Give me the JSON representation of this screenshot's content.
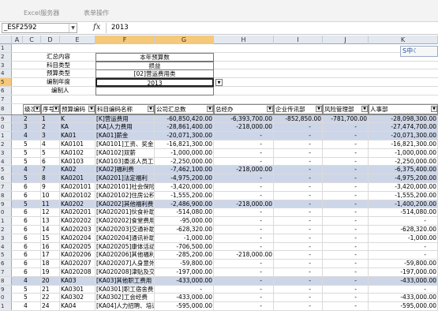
{
  "ribbon": {
    "tab1": "Excel服务器",
    "tab2": "表单操作"
  },
  "formula": {
    "namebox": "_ESF2592",
    "fx": "fx",
    "value": "2013"
  },
  "columns": [
    "A",
    "C",
    "D",
    "E",
    "F",
    "G",
    "H",
    "I",
    "J",
    "K"
  ],
  "row_numbers": [
    "1",
    "2",
    "3",
    "4",
    "5",
    "6",
    "7",
    "8",
    "9",
    "0",
    "1",
    "2",
    "3",
    "4",
    "5",
    "6",
    "7",
    "8",
    "9",
    "0",
    "1",
    "2",
    "3",
    "4",
    "5",
    "6",
    "7",
    "8",
    "9",
    "0",
    "1",
    "2"
  ],
  "form": {
    "l1": "汇总内容",
    "v1": "本年预算数",
    "l2": "科目类型",
    "v2": "损益",
    "l3": "预算类型",
    "v3": "[02]营运费用类",
    "l4": "编制年度",
    "v4": "2013",
    "l5": "编制人",
    "v5": ""
  },
  "headers": [
    "级次",
    "序号",
    "预算编码",
    "科目编码名称",
    "公司汇总数",
    "总经办",
    "企业传讯部",
    "风险管理部",
    "人事部"
  ],
  "ime": "中",
  "rows": [
    [
      "2",
      "1",
      "K",
      "[K]营运费用",
      "-60,850,420.00",
      "-6,393,700.00",
      "-852,850.00",
      "-781,700.00",
      "-28,098,300.00"
    ],
    [
      "3",
      "2",
      "KA",
      "[KA]人力费用",
      "-28,861,400.00",
      "-218,000.00",
      "-",
      "-",
      "-27,474,700.00"
    ],
    [
      "4",
      "3",
      "KA01",
      "[KA01]薪金",
      "-20,071,300.00",
      "-",
      "-",
      "-",
      "-20,071,300.00"
    ],
    [
      "5",
      "4",
      "KA0101",
      "[KA0101]工资、奖金",
      "-16,821,300.00",
      "-",
      "-",
      "-",
      "-16,821,300.00"
    ],
    [
      "5",
      "5",
      "KA0102",
      "[KA0102]双薪",
      "-1,000,000.00",
      "-",
      "-",
      "-",
      "-1,000,000.00"
    ],
    [
      "5",
      "6",
      "KA0103",
      "[KA0103]委派人员工资",
      "-2,250,000.00",
      "-",
      "-",
      "-",
      "-2,250,000.00"
    ],
    [
      "4",
      "7",
      "KA02",
      "[KA02]福利费",
      "-7,462,100.00",
      "-218,000.00",
      "-",
      "-",
      "-6,375,400.00"
    ],
    [
      "5",
      "8",
      "KA0201",
      "[KA0201]法定福利",
      "-4,975,200.00",
      "-",
      "-",
      "-",
      "-4,975,200.00"
    ],
    [
      "6",
      "9",
      "KA020101",
      "[KA020101]社会保险",
      "-3,420,000.00",
      "-",
      "-",
      "-",
      "-3,420,000.00"
    ],
    [
      "6",
      "10",
      "KA020102",
      "[KA020102]住房公积金",
      "-1,555,200.00",
      "-",
      "-",
      "-",
      "-1,555,200.00"
    ],
    [
      "5",
      "11",
      "KA0202",
      "[KA0202]其他福利费",
      "-2,486,900.00",
      "-218,000.00",
      "-",
      "-",
      "-1,400,200.00"
    ],
    [
      "6",
      "12",
      "KA020201",
      "[KA020201]伙食补助",
      "-514,080.00",
      "-",
      "-",
      "-",
      "-514,080.00"
    ],
    [
      "6",
      "13",
      "KA020202",
      "[KA020202]食堂费用",
      "-95,000.00",
      "-",
      "-",
      "-",
      "-"
    ],
    [
      "6",
      "14",
      "KA020203",
      "[KA020203]交通补助",
      "-628,320.00",
      "-",
      "-",
      "-",
      "-628,320.00"
    ],
    [
      "6",
      "15",
      "KA020204",
      "[KA020204]通讯补助",
      "-1,000.00",
      "-",
      "-",
      "-",
      "-1,000.00"
    ],
    [
      "6",
      "16",
      "KA020205",
      "[KA020205]康体活动",
      "-706,500.00",
      "-",
      "-",
      "-",
      "-"
    ],
    [
      "6",
      "17",
      "KA020206",
      "[KA020206]其他福利",
      "-285,200.00",
      "-218,000.00",
      "-",
      "-",
      "-"
    ],
    [
      "6",
      "18",
      "KA020207",
      "[KA020207]人身意外保险",
      "-59,800.00",
      "-",
      "-",
      "-",
      "-59,800.00"
    ],
    [
      "6",
      "19",
      "KA020208",
      "[KA020208]津贴及交通",
      "-197,000.00",
      "-",
      "-",
      "-",
      "-197,000.00"
    ],
    [
      "4",
      "20",
      "KA03",
      "[KA03]其他职工费用",
      "-433,000.00",
      "-",
      "-",
      "-",
      "-433,000.00"
    ],
    [
      "5",
      "21",
      "KA0301",
      "[KA0301]职工宿舍费",
      "-",
      "-",
      "-",
      "-",
      "-"
    ],
    [
      "5",
      "22",
      "KA0302",
      "[KA0302]工会经费",
      "-433,000.00",
      "-",
      "-",
      "-",
      "-433,000.00"
    ],
    [
      "4",
      "24",
      "KA04",
      "[KA04]人力招聘、培训",
      "-595,000.00",
      "-",
      "-",
      "-",
      "-595,000.00"
    ]
  ]
}
